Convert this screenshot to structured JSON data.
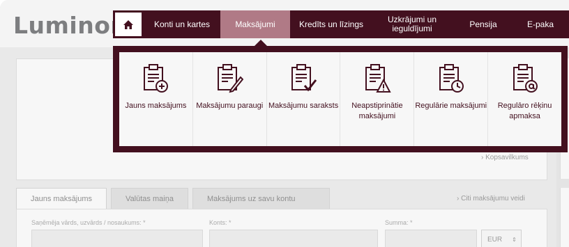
{
  "brand": {
    "logo": "Luminor"
  },
  "nav": {
    "home_icon": "home-icon",
    "items": [
      {
        "label": "Konti un kartes"
      },
      {
        "label": "Maksājumi",
        "active": true
      },
      {
        "label": "Kredīts un līzings"
      },
      {
        "label": "Uzkrājumi un ieguldījumi"
      },
      {
        "label": "Pensija"
      },
      {
        "label": "E-paka"
      }
    ]
  },
  "mega_menu": [
    {
      "icon": "clipboard-plus-icon",
      "label": "Jauns maksājums"
    },
    {
      "icon": "clipboard-pencil-icon",
      "label": "Maksājumu paraugi"
    },
    {
      "icon": "clipboard-check-icon",
      "label": "Maksājumu saraksts"
    },
    {
      "icon": "clipboard-warning-icon",
      "label": "Neapstiprinātie maksājumi"
    },
    {
      "icon": "clipboard-clock-icon",
      "label": "Regulārie maksājumi"
    },
    {
      "icon": "clipboard-at-icon",
      "label": "Regulāro rēķinu apmaksa"
    }
  ],
  "summary_link": "Kopsavilkums",
  "tabs": [
    {
      "label": "Jauns maksājums"
    },
    {
      "label": "Valūtas maiņa"
    },
    {
      "label": "Maksājums uz savu kontu"
    }
  ],
  "other_payments_link": "Citi maksājumu veidi",
  "form": {
    "recipient_label": "Saņēmēja vārds, uzvārds / nosaukums: *",
    "account_label": "Konts: *",
    "amount_label": "Summa: *",
    "currency": "EUR"
  },
  "colors": {
    "brand": "#43101f",
    "active": "#b07a86",
    "background": "#e9e9e9"
  }
}
